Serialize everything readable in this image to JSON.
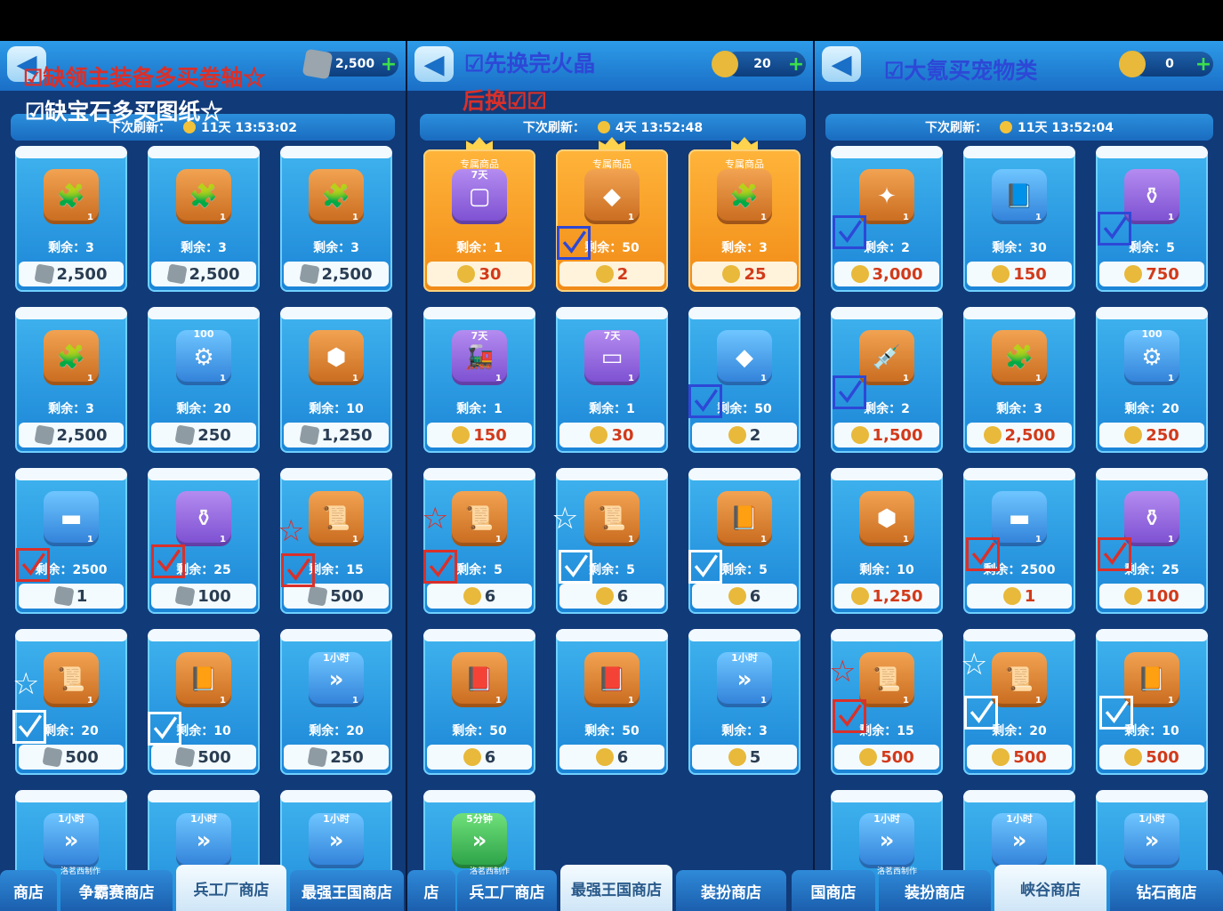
{
  "panels": [
    {
      "currency": {
        "icon": "gem-icon",
        "value": "2,500"
      },
      "refresh": {
        "label": "下次刷新：",
        "time": "11天 13:53:02"
      },
      "cards": [
        {
          "icon": "puzzle-hood-icon",
          "color": "orange",
          "glyph": "🧩",
          "qty": "1",
          "remain": "剩余：3",
          "price": "2,500",
          "ptype": "gem"
        },
        {
          "icon": "puzzle-helmet-icon",
          "color": "orange",
          "glyph": "🧩",
          "qty": "1",
          "remain": "剩余：3",
          "price": "2,500",
          "ptype": "gem"
        },
        {
          "icon": "puzzle-character-icon",
          "color": "orange",
          "glyph": "🧩",
          "qty": "1",
          "remain": "剩余：3",
          "price": "2,500",
          "ptype": "gem"
        },
        {
          "icon": "puzzle-piece-icon",
          "color": "orange",
          "glyph": "🧩",
          "qty": "1",
          "remain": "剩余：3",
          "price": "2,500",
          "ptype": "gem"
        },
        {
          "icon": "gear-nut-icon",
          "color": "blue",
          "glyph": "⚙",
          "badge": "100",
          "qty": "1",
          "remain": "剩余：20",
          "price": "250",
          "ptype": "gem"
        },
        {
          "icon": "stone-hammer-icon",
          "color": "orange",
          "glyph": "⬢",
          "qty": "1",
          "remain": "剩余：10",
          "price": "1,250",
          "ptype": "gem"
        },
        {
          "icon": "iron-ingot-icon",
          "color": "blue",
          "glyph": "▬",
          "qty": "1",
          "remain": "剩余：2500",
          "price": "1",
          "ptype": "gem"
        },
        {
          "icon": "potion-bottle-icon",
          "color": "purple",
          "glyph": "⚱",
          "qty": "1",
          "remain": "剩余：25",
          "price": "100",
          "ptype": "gem"
        },
        {
          "icon": "scroll-icon",
          "color": "orange",
          "glyph": "📜",
          "qty": "1",
          "remain": "剩余：15",
          "price": "500",
          "ptype": "gem"
        },
        {
          "icon": "blueprint-scroll-icon",
          "color": "orange",
          "glyph": "📜",
          "qty": "1",
          "remain": "剩余：20",
          "price": "500",
          "ptype": "gem"
        },
        {
          "icon": "book-icon",
          "color": "orange",
          "glyph": "📙",
          "qty": "1",
          "remain": "剩余：10",
          "price": "500",
          "ptype": "gem"
        },
        {
          "icon": "speedup-icon",
          "color": "blue",
          "glyph": "»",
          "badge": "1小时",
          "qty": "1",
          "remain": "剩余：20",
          "price": "250",
          "ptype": "gem"
        },
        {
          "icon": "speedup-icon",
          "color": "blue",
          "glyph": "»",
          "badge": "1小时",
          "qty": "",
          "remain": "",
          "price": "",
          "ptype": ""
        },
        {
          "icon": "speedup-icon",
          "color": "blue",
          "glyph": "»",
          "badge": "1小时",
          "qty": "",
          "remain": "",
          "price": "",
          "ptype": ""
        },
        {
          "icon": "speedup-icon",
          "color": "blue",
          "glyph": "»",
          "badge": "1小时",
          "qty": "",
          "remain": "",
          "price": "",
          "ptype": ""
        }
      ]
    },
    {
      "currency": {
        "icon": "coin-icon",
        "value": "20"
      },
      "refresh": {
        "label": "下次刷新：",
        "time": "4天 13:52:48"
      },
      "cards": [
        {
          "icon": "avatar-frame-icon",
          "color": "purple",
          "glyph": "▢",
          "badge": "7天",
          "tag": "专属商品",
          "gold": true,
          "qty": "",
          "remain": "剩余：1",
          "price": "30",
          "ptype": "coin"
        },
        {
          "icon": "red-crystal-icon",
          "color": "orange",
          "glyph": "◆",
          "tag": "专属商品",
          "gold": true,
          "qty": "1",
          "remain": "剩余：50",
          "price": "2",
          "ptype": "coin"
        },
        {
          "icon": "puzzle-piece-icon",
          "color": "orange",
          "glyph": "🧩",
          "tag": "专属商品",
          "gold": true,
          "qty": "1",
          "remain": "剩余：3",
          "price": "25",
          "ptype": "coin"
        },
        {
          "icon": "locomotive-icon",
          "color": "purple",
          "glyph": "🚂",
          "badge": "7天",
          "qty": "1",
          "remain": "剩余：1",
          "price": "150",
          "ptype": "coin",
          "red": true
        },
        {
          "icon": "nameplate-icon",
          "color": "purple",
          "glyph": "▭",
          "badge": "7天",
          "qty": "1",
          "remain": "剩余：1",
          "price": "30",
          "ptype": "coin",
          "red": true
        },
        {
          "icon": "red-crystal-icon",
          "color": "blue",
          "glyph": "◆",
          "qty": "1",
          "remain": "剩余：50",
          "price": "2",
          "ptype": "coin"
        },
        {
          "icon": "scroll-icon",
          "color": "orange",
          "glyph": "📜",
          "qty": "1",
          "remain": "剩余：5",
          "price": "6",
          "ptype": "coin"
        },
        {
          "icon": "blueprint-scroll-icon",
          "color": "orange",
          "glyph": "📜",
          "qty": "1",
          "remain": "剩余：5",
          "price": "6",
          "ptype": "coin"
        },
        {
          "icon": "book-icon",
          "color": "orange",
          "glyph": "📙",
          "qty": "1",
          "remain": "剩余：5",
          "price": "6",
          "ptype": "coin"
        },
        {
          "icon": "skill-book-icon",
          "color": "orange",
          "glyph": "📕",
          "qty": "1",
          "remain": "剩余：50",
          "price": "6",
          "ptype": "coin"
        },
        {
          "icon": "flag-book-icon",
          "color": "orange",
          "glyph": "📕",
          "qty": "1",
          "remain": "剩余：50",
          "price": "6",
          "ptype": "coin"
        },
        {
          "icon": "speedup-icon",
          "color": "blue",
          "glyph": "»",
          "badge": "1小时",
          "qty": "1",
          "remain": "剩余：3",
          "price": "5",
          "ptype": "coin"
        },
        {
          "icon": "speedup-icon",
          "color": "green",
          "glyph": "»",
          "badge": "5分钟",
          "qty": "",
          "remain": "",
          "price": "",
          "ptype": ""
        }
      ]
    },
    {
      "currency": {
        "icon": "coin-icon",
        "value": "0"
      },
      "refresh": {
        "label": "下次刷新：",
        "time": "11天 13:52:04"
      },
      "cards": [
        {
          "icon": "claw-gem-icon",
          "color": "orange",
          "glyph": "✦",
          "qty": "1",
          "remain": "剩余：2",
          "price": "3,000",
          "ptype": "coin",
          "red": true
        },
        {
          "icon": "pet-book-icon",
          "color": "blue",
          "glyph": "📘",
          "qty": "1",
          "remain": "剩余：30",
          "price": "150",
          "ptype": "coin",
          "red": true
        },
        {
          "icon": "pet-potion-icon",
          "color": "purple",
          "glyph": "⚱",
          "qty": "1",
          "remain": "剩余：5",
          "price": "750",
          "ptype": "coin",
          "red": true
        },
        {
          "icon": "syringe-icon",
          "color": "orange",
          "glyph": "💉",
          "qty": "1",
          "remain": "剩余：2",
          "price": "1,500",
          "ptype": "coin",
          "red": true
        },
        {
          "icon": "puzzle-piece-icon",
          "color": "orange",
          "glyph": "🧩",
          "qty": "1",
          "remain": "剩余：3",
          "price": "2,500",
          "ptype": "coin",
          "red": true
        },
        {
          "icon": "gear-nut-icon",
          "color": "blue",
          "glyph": "⚙",
          "badge": "100",
          "qty": "1",
          "remain": "剩余：20",
          "price": "250",
          "ptype": "coin",
          "red": true
        },
        {
          "icon": "stone-hammer-icon",
          "color": "orange",
          "glyph": "⬢",
          "qty": "1",
          "remain": "剩余：10",
          "price": "1,250",
          "ptype": "coin",
          "red": true
        },
        {
          "icon": "iron-ingot-icon",
          "color": "blue",
          "glyph": "▬",
          "qty": "1",
          "remain": "剩余：2500",
          "price": "1",
          "ptype": "coin",
          "red": true
        },
        {
          "icon": "potion-bottle-icon",
          "color": "purple",
          "glyph": "⚱",
          "qty": "1",
          "remain": "剩余：25",
          "price": "100",
          "ptype": "coin",
          "red": true
        },
        {
          "icon": "scroll-icon",
          "color": "orange",
          "glyph": "📜",
          "qty": "1",
          "remain": "剩余：15",
          "price": "500",
          "ptype": "coin",
          "red": true
        },
        {
          "icon": "blueprint-scroll-icon",
          "color": "orange",
          "glyph": "📜",
          "qty": "1",
          "remain": "剩余：20",
          "price": "500",
          "ptype": "coin",
          "red": true
        },
        {
          "icon": "book-icon",
          "color": "orange",
          "glyph": "📙",
          "qty": "1",
          "remain": "剩余：10",
          "price": "500",
          "ptype": "coin",
          "red": true
        },
        {
          "icon": "speedup-icon",
          "color": "blue",
          "glyph": "»",
          "badge": "1小时",
          "qty": "",
          "remain": "",
          "price": "",
          "ptype": ""
        },
        {
          "icon": "speedup-icon",
          "color": "blue",
          "glyph": "»",
          "badge": "1小时",
          "qty": "",
          "remain": "",
          "price": "",
          "ptype": ""
        },
        {
          "icon": "speedup-icon",
          "color": "blue",
          "glyph": "»",
          "badge": "1小时",
          "qty": "",
          "remain": "",
          "price": "",
          "ptype": ""
        }
      ]
    }
  ],
  "tabs": [
    "商店",
    "争霸赛商店",
    "兵工厂商店",
    "最强王国商店",
    "店",
    "兵工厂商店",
    "最强王国商店",
    "装扮商店",
    "国商店",
    "装扮商店",
    "峡谷商店",
    "钻石商店"
  ],
  "watermark": "洛茗西制作",
  "annotations": {
    "note1": "☑缺领主装备多买卷轴☆",
    "note2": "☑缺宝石多买图纸☆",
    "note3": "☑先换完火晶",
    "note4": "后换☑☑",
    "note5": "☑大氪买宠物类"
  },
  "colors": {
    "red_mark": "#d9302a",
    "blue_mark": "#2d48d6",
    "panel_bg": "#113a78",
    "price_red": "#d23a1a"
  }
}
